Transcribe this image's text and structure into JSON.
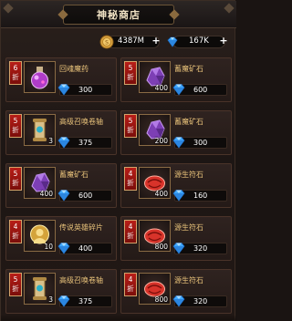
{
  "title": "神秘商店",
  "currencies": [
    {
      "icon": "gold-coin-icon",
      "amount": "4387M",
      "plus": "+"
    },
    {
      "icon": "diamond-icon",
      "amount": "167K",
      "plus": "+"
    }
  ],
  "items": [
    {
      "discount_num": "6",
      "discount_unit": "折",
      "name": "回魂魔药",
      "icon": "potion-icon",
      "qty": "",
      "price": "300"
    },
    {
      "discount_num": "5",
      "discount_unit": "折",
      "name": "蓄魔矿石",
      "icon": "purple-ore-icon",
      "qty": "400",
      "price": "600"
    },
    {
      "discount_num": "5",
      "discount_unit": "折",
      "name": "高级召唤卷轴",
      "icon": "summon-scroll-icon",
      "qty": "3",
      "price": "375"
    },
    {
      "discount_num": "5",
      "discount_unit": "折",
      "name": "蓄魔矿石",
      "icon": "purple-ore-icon",
      "qty": "200",
      "price": "300"
    },
    {
      "discount_num": "5",
      "discount_unit": "折",
      "name": "蓄魔矿石",
      "icon": "purple-ore-icon",
      "qty": "400",
      "price": "600"
    },
    {
      "discount_num": "4",
      "discount_unit": "折",
      "name": "源生符石",
      "icon": "red-rune-icon",
      "qty": "400",
      "price": "160"
    },
    {
      "discount_num": "4",
      "discount_unit": "折",
      "name": "传说英雄碎片",
      "icon": "hero-shard-icon",
      "qty": "10",
      "price": "400"
    },
    {
      "discount_num": "4",
      "discount_unit": "折",
      "name": "源生符石",
      "icon": "red-rune-icon",
      "qty": "800",
      "price": "320"
    },
    {
      "discount_num": "5",
      "discount_unit": "折",
      "name": "高级召唤卷轴",
      "icon": "summon-scroll-icon",
      "qty": "3",
      "price": "375"
    },
    {
      "discount_num": "4",
      "discount_unit": "折",
      "name": "源生符石",
      "icon": "red-rune-icon",
      "qty": "800",
      "price": "320"
    }
  ]
}
